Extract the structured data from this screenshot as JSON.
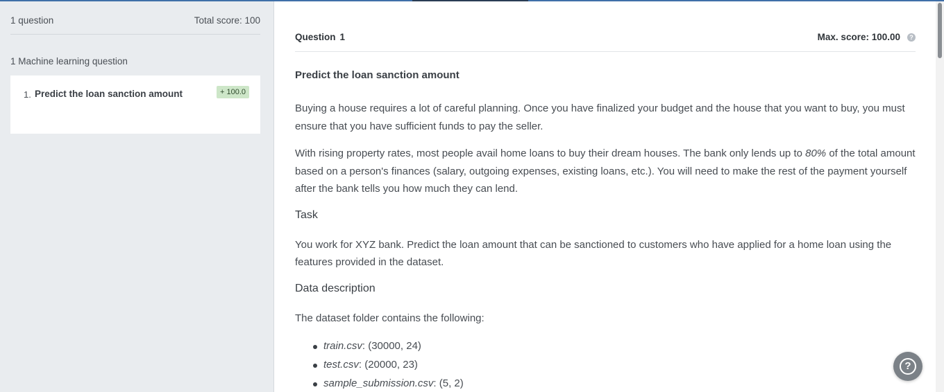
{
  "sidebar": {
    "question_count": "1 question",
    "total_score": "Total score: 100",
    "section_label": "1 Machine learning question",
    "items": [
      {
        "number": "1.",
        "title": "Predict the loan sanction amount",
        "badge": "+ 100.0"
      }
    ]
  },
  "question": {
    "label": "Question",
    "number": "1",
    "max_score": "Max. score: 100.00",
    "help_icon": "question-circle-icon",
    "title": "Predict the loan sanction amount",
    "para1": "Buying a house requires a lot of careful planning. Once you have finalized your budget and the house that you want to buy, you must ensure that you have sufficient funds to pay the seller.",
    "para2_before": "With rising property rates, most people avail home loans to buy their dream houses. The bank only lends up to ",
    "para2_em": "80%",
    "para2_after": " of the total amount based on a person's finances (salary, outgoing expenses, existing loans, etc.). You will need to make the rest of the payment yourself after the bank tells you how much they can lend.",
    "task_heading": "Task",
    "task_text": "You work for XYZ bank. Predict the loan amount that can be sanctioned to customers who have applied for a home loan using the features provided in the dataset.",
    "data_heading": "Data description",
    "data_intro": "The dataset folder contains the following:",
    "files": [
      {
        "name": "train.csv",
        "shape": ": (30000, 24)"
      },
      {
        "name": "test.csv",
        "shape": ": (20000, 23)"
      },
      {
        "name": "sample_submission.csv",
        "shape": ": (5, 2)"
      }
    ]
  },
  "help_button": {
    "icon": "help-circle-icon",
    "glyph": "?"
  },
  "colors": {
    "sidebar_bg": "#e9ecef",
    "badge_bg": "#cde6c8",
    "accent_line": "#3f6fa8",
    "fab_bg": "#7b8187"
  }
}
